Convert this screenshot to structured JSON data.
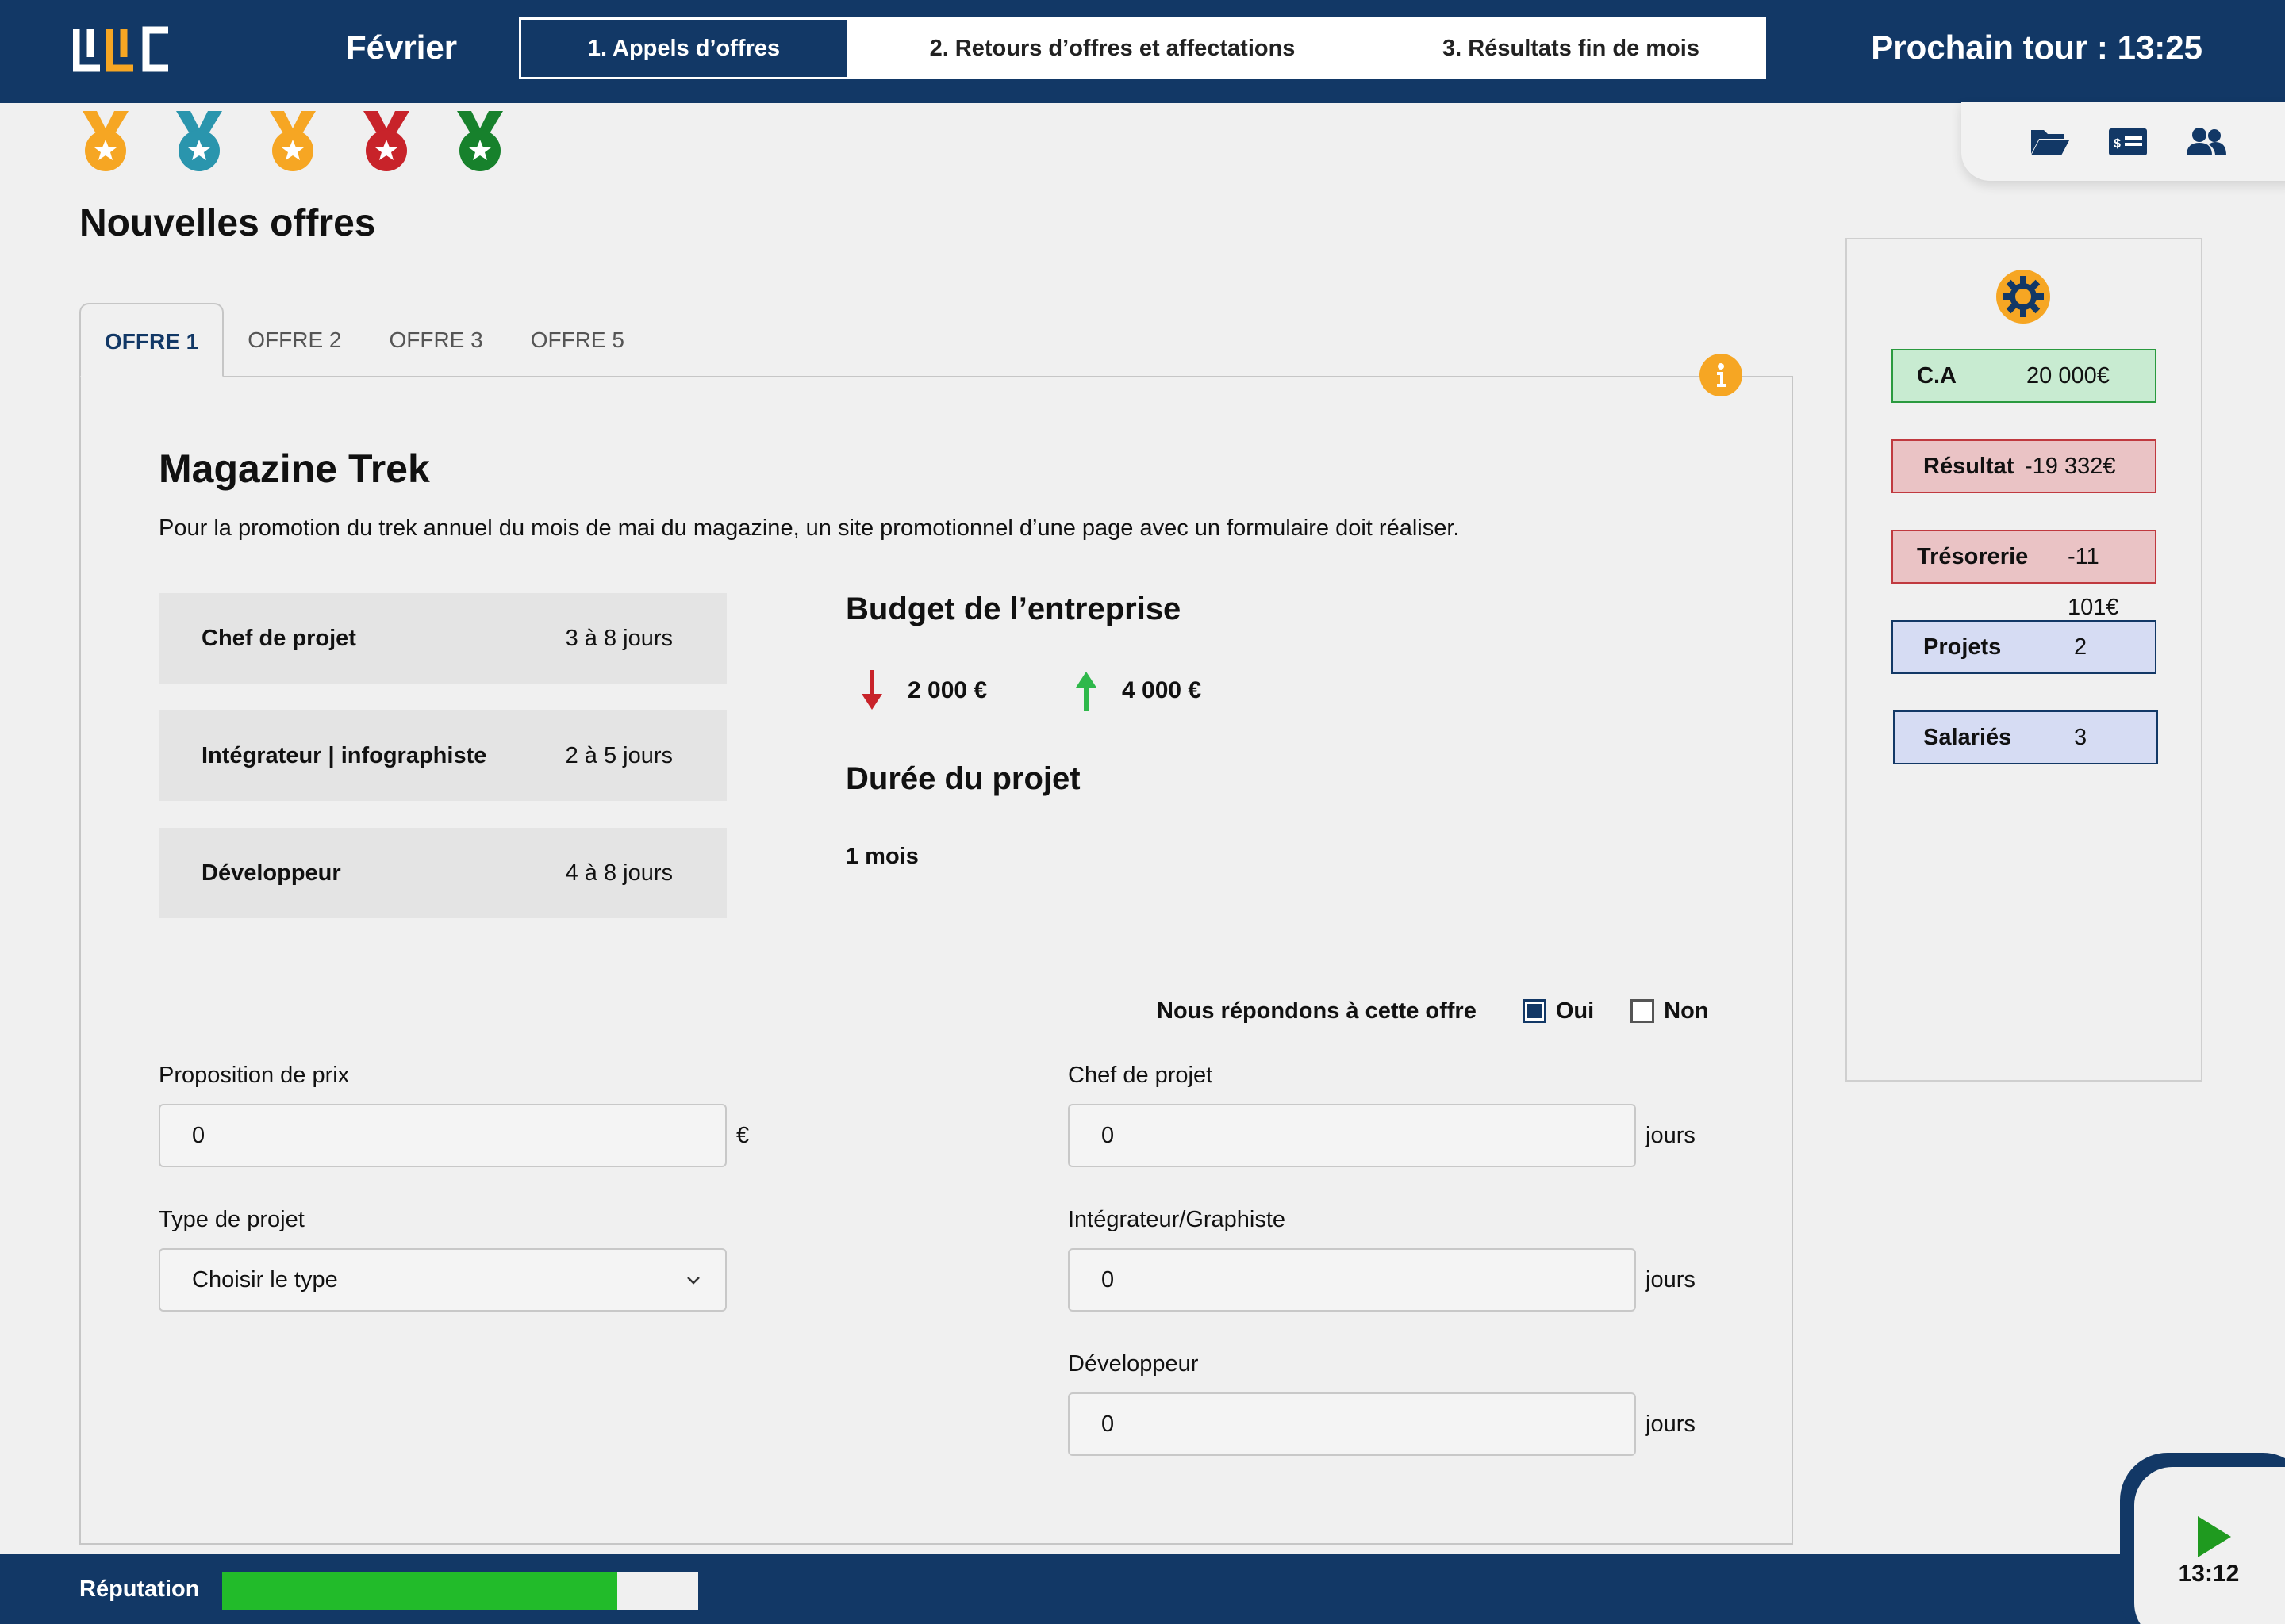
{
  "header": {
    "month": "Février",
    "steps": [
      "1. Appels d’offres",
      "2. Retours d’offres et affectations",
      "3. Résultats fin de mois"
    ],
    "active_step": 0,
    "next_round": "Prochain tour : 13:25"
  },
  "medals": [
    {
      "icon": "gold-medal-icon",
      "color": "#f6a623"
    },
    {
      "icon": "teal-medal-icon",
      "color": "#2a95ad"
    },
    {
      "icon": "gold-medal-icon",
      "color": "#f6a623"
    },
    {
      "icon": "red-medal-icon",
      "color": "#c8232a"
    },
    {
      "icon": "green-medal-icon",
      "color": "#17812c"
    }
  ],
  "toolbar": {
    "icons": [
      "folder-open-icon",
      "id-card-icon",
      "users-icon"
    ]
  },
  "page_title": "Nouvelles offres",
  "tabs": [
    "OFFRE 1",
    "OFFRE 2",
    "OFFRE 3",
    "OFFRE 5"
  ],
  "offer": {
    "title": "Magazine Trek",
    "description": "Pour la promotion du trek annuel du mois de mai du magazine, un site promotionnel d’une page avec un formulaire doit réaliser.",
    "roles": [
      {
        "name": "Chef de projet",
        "days": "3 à 8 jours"
      },
      {
        "name": "Intégrateur | infographiste",
        "days": "2 à 5 jours"
      },
      {
        "name": "Développeur",
        "days": "4 à 8 jours"
      }
    ],
    "budget_heading": "Budget de l’entreprise",
    "budget_min": "2 000 €",
    "budget_max": "4 000 €",
    "duration_heading": "Durée du projet",
    "duration": "1 mois"
  },
  "respond": {
    "label": "Nous répondons à cette offre",
    "yes": "Oui",
    "no": "Non",
    "selected": "Oui"
  },
  "form": {
    "price_label": "Proposition de prix",
    "price_value": "0",
    "price_unit": "€",
    "type_label": "Type de projet",
    "type_value": "Choisir le type",
    "pm_label": "Chef de projet",
    "pm_value": "0",
    "int_label": "Intégrateur/Graphiste",
    "int_value": "0",
    "dev_label": "Développeur",
    "dev_value": "0",
    "days_unit": "jours"
  },
  "stats": [
    {
      "label": "C.A",
      "value": "20 000€",
      "bg": "#c8ebd1",
      "border": "#2a9a3f"
    },
    {
      "label": "Résultat",
      "value": "-19 332€",
      "bg": "#eac3c5",
      "border": "#c0393f"
    },
    {
      "label": "Trésorerie",
      "value": "-11 101€",
      "bg": "#eac3c5",
      "border": "#c0393f"
    },
    {
      "label": "Projets",
      "value": "2",
      "bg": "#d6dcf3",
      "border": "#123866"
    },
    {
      "label": "Salariés",
      "value": "3",
      "bg": "#d6dcf3",
      "border": "#123866"
    }
  ],
  "footer": {
    "reputation_label": "Réputation",
    "reputation_fraction": 0.83,
    "timer": "13:12"
  },
  "colors": {
    "brand": "#123866",
    "accent": "#f6a623",
    "progress": "#22bb2a"
  }
}
